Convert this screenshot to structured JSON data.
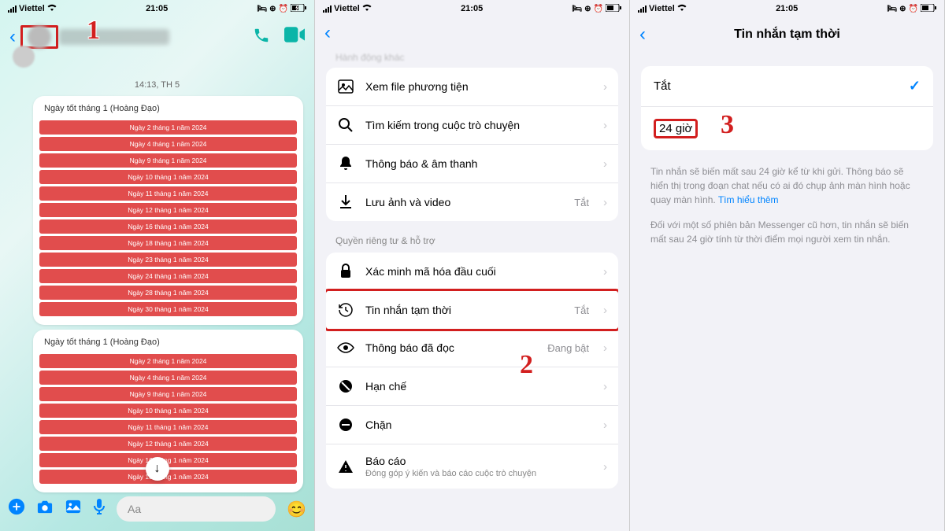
{
  "status": {
    "carrier": "Viettel",
    "time": "21:05"
  },
  "step_numbers": {
    "one": "1",
    "two": "2",
    "three": "3"
  },
  "screen1": {
    "timestamp": "14:13, TH 5",
    "card1_title": "Ngày tốt tháng 1 (Hoàng Đạo)",
    "card1_dates": [
      "Ngày 2 tháng 1 năm 2024",
      "Ngày 4 tháng 1 năm 2024",
      "Ngày 9 tháng 1 năm 2024",
      "Ngày 10 tháng 1 năm 2024",
      "Ngày 11 tháng 1 năm 2024",
      "Ngày 12 tháng 1 năm 2024",
      "Ngày 16 tháng 1 năm 2024",
      "Ngày 18 tháng 1 năm 2024",
      "Ngày 23 tháng 1 năm 2024",
      "Ngày 24 tháng 1 năm 2024",
      "Ngày 28 tháng 1 năm 2024",
      "Ngày 30 tháng 1 năm 2024"
    ],
    "card2_title": "Ngày tốt tháng 1 (Hoàng Đạo)",
    "card2_dates": [
      "Ngày 2 tháng 1 năm 2024",
      "Ngày 4 tháng 1 năm 2024",
      "Ngày 9 tháng 1 năm 2024",
      "Ngày 10 tháng 1 năm 2024",
      "Ngày 11 tháng 1 năm 2024",
      "Ngày 12 tháng 1 năm 2024",
      "Ngày 16 tháng 1 năm 2024",
      "Ngày 18 tháng 1 năm 2024"
    ],
    "composer_placeholder": "Aa"
  },
  "screen2": {
    "header_partial": "Hành động khác",
    "group1": {
      "media": "Xem file phương tiện",
      "search": "Tìm kiếm trong cuộc trò chuyện",
      "notif": "Thông báo & âm thanh",
      "save": "Lưu ảnh và video",
      "save_val": "Tắt"
    },
    "section2": "Quyền riêng tư & hỗ trợ",
    "group2": {
      "verify": "Xác minh mã hóa đầu cuối",
      "disappear": "Tin nhắn tạm thời",
      "disappear_val": "Tắt",
      "read": "Thông báo đã đọc",
      "read_val": "Đang bật",
      "restrict": "Hạn chế",
      "block": "Chặn",
      "report": "Báo cáo",
      "report_sub": "Đóng góp ý kiến và báo cáo cuộc trò chuyện"
    }
  },
  "screen3": {
    "title": "Tin nhắn tạm thời",
    "opt_off": "Tắt",
    "opt_24": "24 giờ",
    "desc1a": "Tin nhắn sẽ biến mất sau 24 giờ kể từ khi gửi. Thông báo sẽ hiển thị trong đoạn chat nếu có ai đó chụp ảnh màn hình hoặc quay màn hình. ",
    "desc1_link": "Tìm hiểu thêm",
    "desc2": "Đối với một số phiên bản Messenger cũ hơn, tin nhắn sẽ biến mất sau 24 giờ tính từ thời điểm mọi người xem tin nhắn."
  }
}
